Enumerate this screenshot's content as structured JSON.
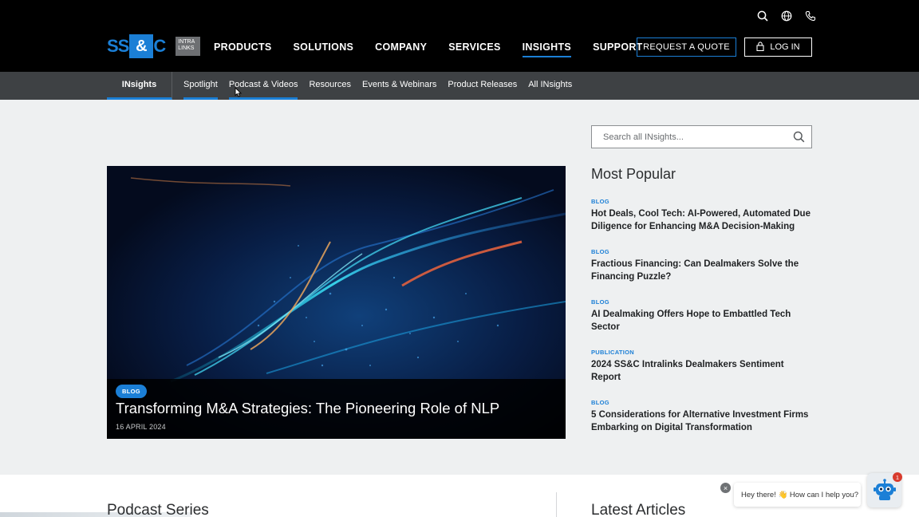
{
  "header": {
    "logo": {
      "ss": "SS",
      "amp": "&",
      "c": "C",
      "sub_line1": "INTRA",
      "sub_line2": "LINKS"
    },
    "utility_icons": [
      "search-icon",
      "globe-icon",
      "phone-icon"
    ],
    "nav": [
      {
        "label": "PRODUCTS"
      },
      {
        "label": "SOLUTIONS"
      },
      {
        "label": "COMPANY"
      },
      {
        "label": "SERVICES"
      },
      {
        "label": "INSIGHTS"
      },
      {
        "label": "SUPPORT"
      }
    ],
    "request_quote": "REQUEST A QUOTE",
    "login": "LOG IN"
  },
  "subnav": {
    "home": "INsights",
    "links": [
      {
        "label": "Spotlight"
      },
      {
        "label": "Podcast & Videos"
      },
      {
        "label": "Resources"
      },
      {
        "label": "Events & Webinars"
      },
      {
        "label": "Product Releases"
      },
      {
        "label": "All INsights"
      }
    ]
  },
  "search": {
    "placeholder": "Search all INsights..."
  },
  "hero": {
    "badge": "BLOG",
    "title": "Transforming M&A Strategies: The Pioneering Role of NLP",
    "date": "16 APRIL 2024"
  },
  "popular": {
    "title": "Most Popular",
    "items": [
      {
        "category": "BLOG",
        "title": "Hot Deals, Cool Tech: AI-Powered, Automated Due Diligence for Enhancing M&A Decision-Making"
      },
      {
        "category": "BLOG",
        "title": "Fractious Financing: Can Dealmakers Solve the Financing Puzzle?"
      },
      {
        "category": "BLOG",
        "title": "AI Dealmaking Offers Hope to Embattled Tech Sector"
      },
      {
        "category": "PUBLICATION",
        "title": "2024 SS&C Intralinks Dealmakers Sentiment Report"
      },
      {
        "category": "BLOG",
        "title": "5 Considerations for Alternative Investment Firms Embarking on Digital Transformation"
      }
    ]
  },
  "lower": {
    "left_heading": "Podcast Series",
    "right_heading": "Latest Articles"
  },
  "chat": {
    "close": "×",
    "message": "Hey there! 👋 How can I help you?",
    "badge_count": "1"
  },
  "colors": {
    "accent": "#1b7fd6",
    "header_bg": "#000000",
    "subnav_bg": "#3e4144",
    "page_bg": "#eef0f1"
  }
}
